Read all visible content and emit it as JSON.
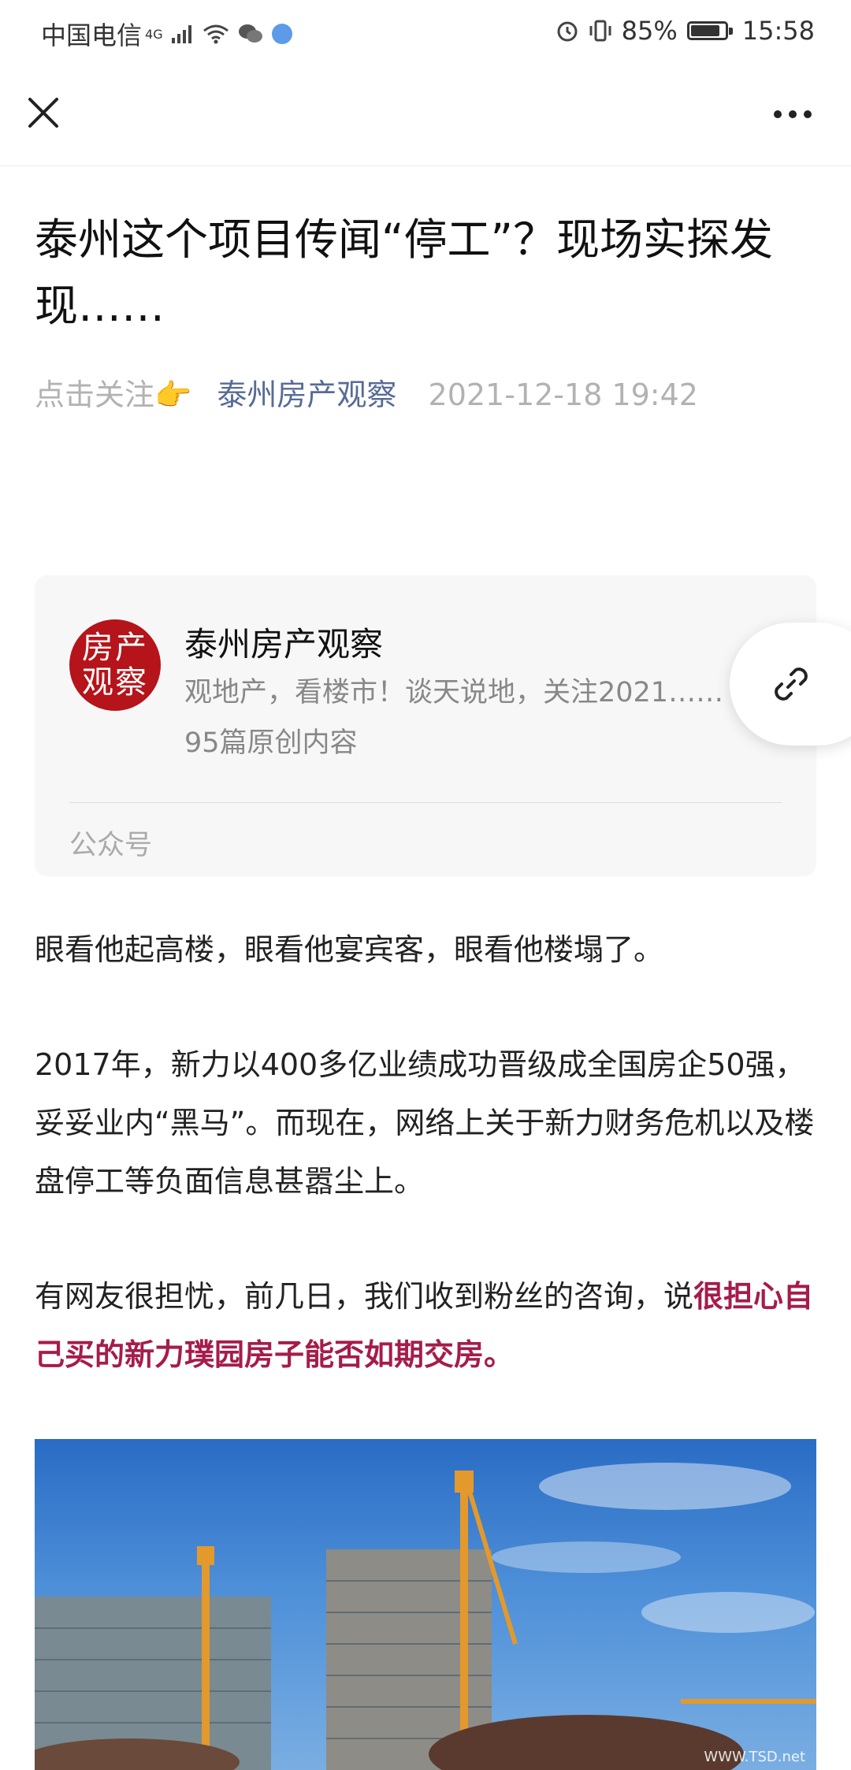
{
  "status_bar": {
    "carrier": "中国电信",
    "network": "4G",
    "battery": "85%",
    "battery_level": 0.85,
    "time": "15:58"
  },
  "nav": {
    "close_icon": "close-icon",
    "more_icon": "more-icon"
  },
  "article": {
    "title": "泰州这个项目传闻“停工”？现场实探发现……",
    "follow_prompt": "点击关注👉",
    "author": "泰州房产观察",
    "datetime": "2021-12-18 19:42"
  },
  "account_card": {
    "avatar_text_1": "房产",
    "avatar_text_2": "观察",
    "name": "泰州房产观察",
    "description": "观地产，看楼市！谈天说地，关注2021……",
    "original_count": "95篇原创内容",
    "label": "公众号"
  },
  "content": {
    "p1": "眼看他起高楼，眼看他宴宾客，眼看他楼塌了。",
    "p2": "2017年，新力以400多亿业绩成功晋级成全国房企50强，妥妥业内“黑马”。而现在，网络上关于新力财务危机以及楼盘停工等负面信息甚嚣尘上。",
    "p3_normal": "有网友很担忧，前几日，我们收到粉丝的咨询，说",
    "p3_highlight": "很担心自己买的新力璞园房子能否如期交房。"
  },
  "photo": {
    "watermark": "WWW.TSD.net"
  },
  "colors": {
    "author_link": "#576b95",
    "highlight": "#a51c4a",
    "avatar_bg": "#b5141a"
  }
}
